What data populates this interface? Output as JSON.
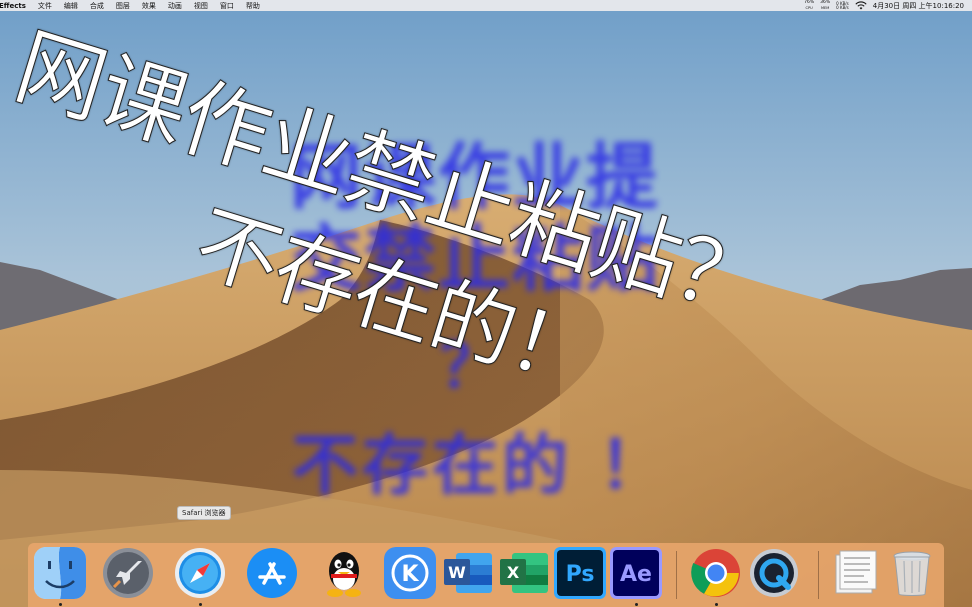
{
  "menubar": {
    "app_name": "Effects",
    "menus": [
      "文件",
      "编辑",
      "合成",
      "图层",
      "效果",
      "动画",
      "视图",
      "窗口",
      "帮助"
    ],
    "cpu": {
      "value": "76%",
      "label": "CPU"
    },
    "mem": {
      "value": "36%",
      "label": "MEM"
    },
    "net_up": "0 KB/s",
    "net_down": "0 KB/s",
    "clock": "4月30日 周四 上午10:16:20"
  },
  "overlay": {
    "white_line_1": "网课作业禁止粘贴？",
    "white_line_2": "不存在的！",
    "blue_line_1": "网课作业提",
    "blue_line_2": "交禁止粘贴",
    "blue_line_3": "？",
    "blue_line_4": "不存在的 ！"
  },
  "dock": {
    "tooltip": "Safari 浏览器",
    "icons": [
      {
        "name": "finder-icon"
      },
      {
        "name": "launchpad-icon"
      },
      {
        "name": "safari-icon"
      },
      {
        "name": "app-store-icon"
      },
      {
        "name": "qq-icon"
      },
      {
        "name": "kuaiyin-icon",
        "glyph": "K"
      },
      {
        "name": "word-icon",
        "glyph": "W"
      },
      {
        "name": "excel-icon",
        "glyph": "X"
      },
      {
        "name": "photoshop-icon",
        "glyph": "Ps"
      },
      {
        "name": "after-effects-icon",
        "glyph": "Ae"
      },
      {
        "name": "chrome-icon"
      },
      {
        "name": "quicktime-icon"
      },
      {
        "name": "document-icon"
      },
      {
        "name": "trash-icon"
      }
    ]
  },
  "colors": {
    "dock_bg": "#e8a66c",
    "ps_bg": "#001e36",
    "ps_fg": "#31a8ff",
    "ae_bg": "#00005b",
    "ae_fg": "#9999ff",
    "word": "#2b579a",
    "excel": "#217346",
    "caption_blue": "#2a2ae6"
  }
}
